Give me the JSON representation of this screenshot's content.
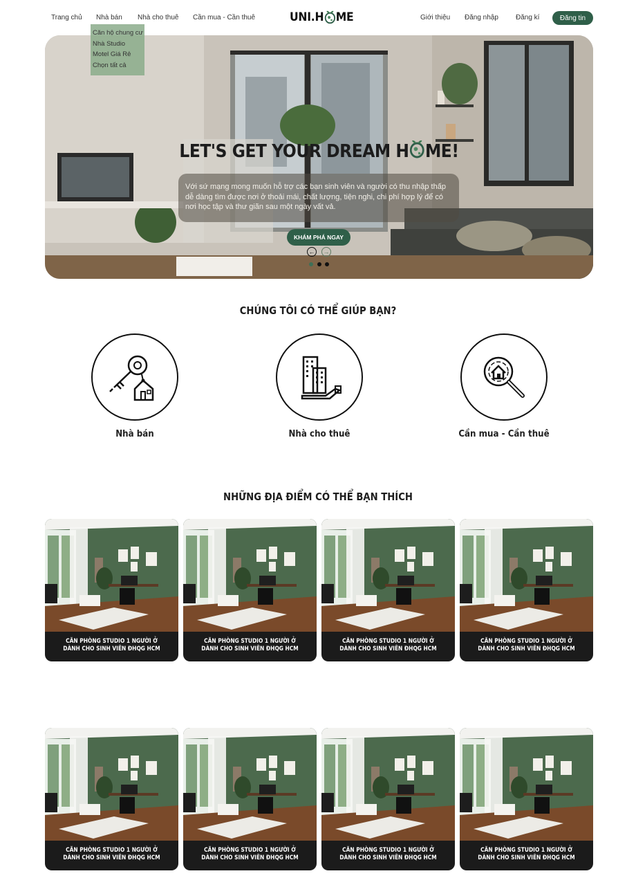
{
  "nav": {
    "left": [
      "Trang chủ",
      "Nhà bán",
      "Nhà cho thuê",
      "Cần mua - Cần thuê"
    ],
    "logo_prefix": "UNI.H",
    "logo_suffix": "ME",
    "right": [
      "Giới thiệu",
      "Đăng nhập",
      "Đăng kí"
    ],
    "post_button": "Đăng tin"
  },
  "dropdown": [
    "Căn hộ chung cư",
    "Nhà Studio",
    "Motel Giá Rẻ",
    "Chọn tất cả"
  ],
  "hero": {
    "title_prefix": "LET'S GET YOUR DREAM H",
    "title_suffix": "ME!",
    "description": "Với sứ mạng mong muốn hỗ trợ các bạn sinh viên và người có thu nhập thấp dễ dàng tìm được nơi ở thoải mái, chất lượng, tiện nghi, chi phí hợp lý để có nơi học tập và thư giãn sau một ngày vất vả.",
    "cta": "KHÁM PHÁ NGAY",
    "slides": 3,
    "active_slide": 1
  },
  "services": {
    "title": "CHÚNG TÔI CÓ THỂ GIÚP BẠN?",
    "items": [
      {
        "label": "Nhà bán",
        "icon": "key-house-icon"
      },
      {
        "label": "Nhà cho thuê",
        "icon": "building-hand-icon"
      },
      {
        "label": "Cần mua - Cần thuê",
        "icon": "house-search-icon"
      }
    ]
  },
  "places": {
    "title": "NHỮNG ĐỊA ĐIỂM CÓ THỂ BẠN THÍCH",
    "cards": [
      {
        "line1": "CĂN PHÒNG STUDIO 1 NGƯỜI Ở",
        "line2": "DÀNH CHO SINH VIÊN ĐHQG HCM"
      },
      {
        "line1": "CĂN PHÒNG STUDIO 1 NGƯỜI Ở",
        "line2": "DÀNH CHO SINH VIÊN ĐHQG HCM"
      },
      {
        "line1": "CĂN PHÒNG STUDIO 1 NGƯỜI Ở",
        "line2": "DÀNH CHO SINH VIÊN ĐHQG HCM"
      },
      {
        "line1": "CĂN PHÒNG STUDIO 1 NGƯỜI Ở",
        "line2": "DÀNH CHO SINH VIÊN ĐHQG HCM"
      },
      {
        "line1": "CĂN PHÒNG STUDIO 1 NGƯỜI Ở",
        "line2": "DÀNH CHO SINH VIÊN ĐHQG HCM"
      },
      {
        "line1": "CĂN PHÒNG STUDIO 1 NGƯỜI Ở",
        "line2": "DÀNH CHO SINH VIÊN ĐHQG HCM"
      },
      {
        "line1": "CĂN PHÒNG STUDIO 1 NGƯỜI Ở",
        "line2": "DÀNH CHO SINH VIÊN ĐHQG HCM"
      },
      {
        "line1": "CĂN PHÒNG STUDIO 1 NGƯỜI Ở",
        "line2": "DÀNH CHO SINH VIÊN ĐHQG HCM"
      }
    ]
  },
  "colors": {
    "brand_green": "#2f5f49",
    "dropdown_bg": "#8bab8b",
    "card_bg": "#1b1b1b"
  }
}
